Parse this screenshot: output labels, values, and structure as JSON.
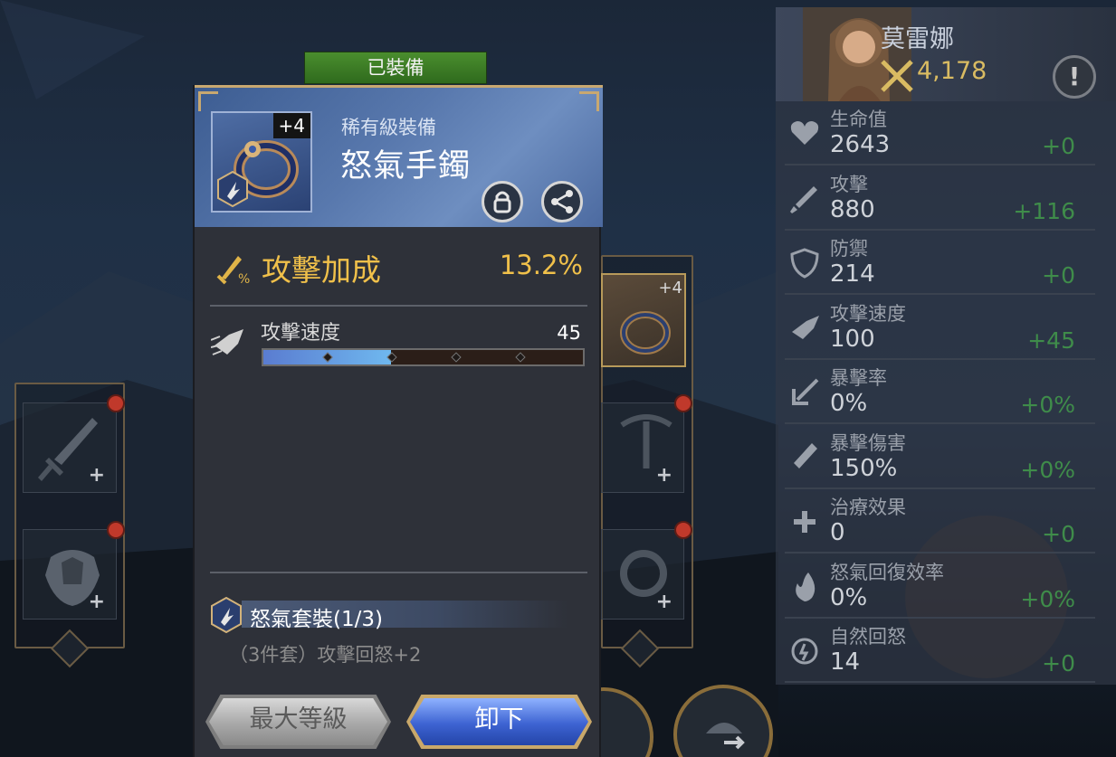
{
  "equipped_badge": "已裝備",
  "item": {
    "level": "+4",
    "rarity": "稀有級裝備",
    "name": "怒氣手鐲",
    "main_stat": {
      "label": "攻擊加成",
      "value": "13.2%"
    },
    "sub_stat": {
      "label": "攻擊速度",
      "value": "45",
      "fill_fraction": 0.4
    },
    "set": {
      "title": "怒氣套裝(1/3)",
      "bonus": "（3件套）攻擊回怒+2"
    },
    "buttons": {
      "max_level": "最大等級",
      "unequip": "卸下"
    }
  },
  "other_item": {
    "level": "+4"
  },
  "hero": {
    "name": "莫雷娜",
    "power": "4,178",
    "alert": "!"
  },
  "stats": [
    {
      "name": "生命值",
      "value": "2643",
      "bonus": "+0",
      "icon": "heart-icon"
    },
    {
      "name": "攻擊",
      "value": "880",
      "bonus": "+116",
      "icon": "sword-icon"
    },
    {
      "name": "防禦",
      "value": "214",
      "bonus": "+0",
      "icon": "shield-icon"
    },
    {
      "name": "攻擊速度",
      "value": "100",
      "bonus": "+45",
      "icon": "wing-icon"
    },
    {
      "name": "暴擊率",
      "value": "0%",
      "bonus": "+0%",
      "icon": "crit-arrow-icon"
    },
    {
      "name": "暴擊傷害",
      "value": "150%",
      "bonus": "+0%",
      "icon": "crit-blade-icon"
    },
    {
      "name": "治療效果",
      "value": "0",
      "bonus": "+0",
      "icon": "heal-plus-icon"
    },
    {
      "name": "怒氣回復效率",
      "value": "0%",
      "bonus": "+0%",
      "icon": "flame-icon"
    },
    {
      "name": "自然回怒",
      "value": "14",
      "bonus": "+0",
      "icon": "regen-icon"
    }
  ],
  "colors": {
    "gold": "#f0c04a",
    "green_bonus": "#3f8c4a",
    "equipped_green": "#3f7e27",
    "button_blue": "#3d63d2"
  }
}
